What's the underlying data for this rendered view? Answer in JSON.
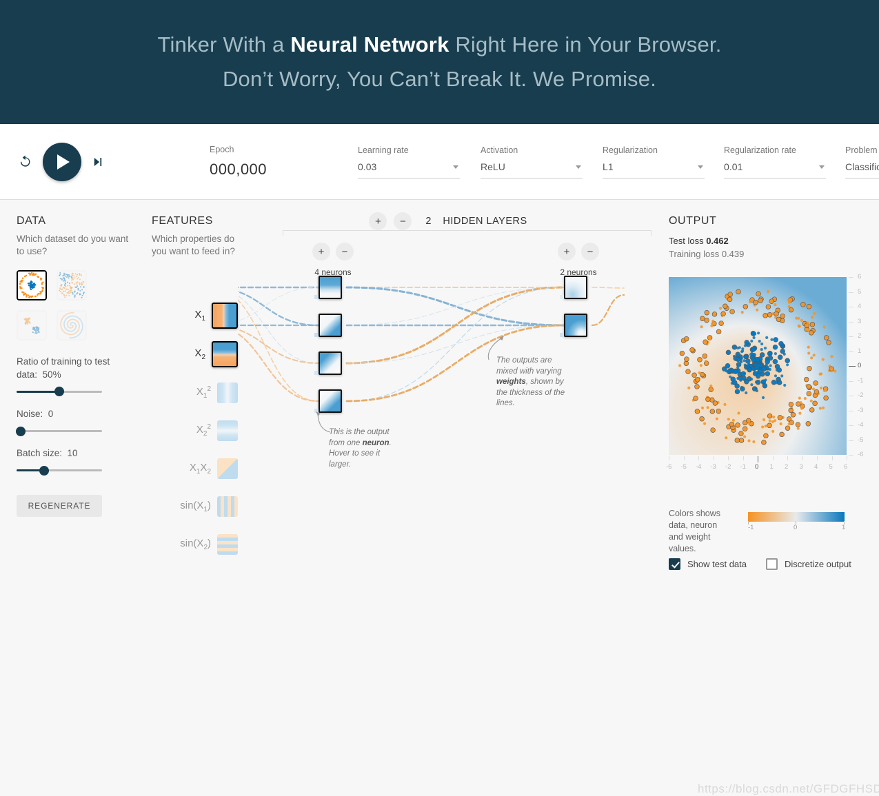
{
  "header": {
    "line1_pre": "Tinker With a ",
    "line1_strong": "Neural Network",
    "line1_post": " Right Here in Your Browser.",
    "line2": "Don’t Worry, You Can’t Break It. We Promise."
  },
  "toolbar": {
    "reset_icon": "reset-icon",
    "play_icon": "play-icon",
    "step_icon": "step-forward-icon",
    "epoch_label": "Epoch",
    "epoch_value": "000,000",
    "learning_rate_label": "Learning rate",
    "learning_rate_value": "0.03",
    "activation_label": "Activation",
    "activation_value": "ReLU",
    "regularization_label": "Regularization",
    "regularization_value": "L1",
    "regularization_rate_label": "Regularization rate",
    "regularization_rate_value": "0.01",
    "problem_type_label": "Problem type",
    "problem_type_value": "Classification"
  },
  "data": {
    "title": "DATA",
    "subtitle": "Which dataset do you want to use?",
    "datasets": [
      {
        "name": "circle",
        "selected": true
      },
      {
        "name": "xor",
        "selected": false
      },
      {
        "name": "gauss",
        "selected": false
      },
      {
        "name": "spiral",
        "selected": false
      }
    ],
    "ratio_label": "Ratio of training to test data:",
    "ratio_value": "50%",
    "ratio_pct": 50,
    "noise_label": "Noise:",
    "noise_value": "0",
    "noise_pct": 0,
    "batch_label": "Batch size:",
    "batch_value": "10",
    "batch_pct": 33,
    "regenerate_label": "REGENERATE"
  },
  "features": {
    "title": "FEATURES",
    "subtitle": "Which properties do you want to feed in?",
    "items": [
      {
        "label": "X₁",
        "active": true
      },
      {
        "label": "X₂",
        "active": true
      },
      {
        "label": "X₁²",
        "active": false
      },
      {
        "label": "X₂²",
        "active": false
      },
      {
        "label": "X₁X₂",
        "active": false
      },
      {
        "label": "sin(X₁)",
        "active": false
      },
      {
        "label": "sin(X₂)",
        "active": false
      }
    ]
  },
  "network": {
    "hidden_layer_count": "2",
    "hidden_layers_label": "HIDDEN LAYERS",
    "add_layer_label": "+",
    "remove_layer_label": "−",
    "layers": [
      {
        "neurons_label": "4 neurons",
        "count": 4
      },
      {
        "neurons_label": "2 neurons",
        "count": 2
      }
    ],
    "callout_neuron": {
      "pre": "This is the output from one ",
      "strong": "neuron",
      "post": ". Hover to see it larger."
    },
    "callout_weights": {
      "pre": "The outputs are mixed with varying ",
      "strong": "weights",
      "post": ", shown by the thickness of the lines."
    }
  },
  "output": {
    "title": "OUTPUT",
    "test_loss_label": "Test loss",
    "test_loss_value": "0.462",
    "training_loss_label": "Training loss",
    "training_loss_value": "0.439",
    "legend_text": "Colors shows data, neuron and weight values.",
    "legend_min": "-1",
    "legend_mid": "0",
    "legend_max": "1",
    "show_test_data_label": "Show test data",
    "show_test_data_checked": true,
    "discretize_label": "Discretize output",
    "discretize_checked": false,
    "axis_ticks": [
      "-6",
      "-5",
      "-4",
      "-3",
      "-2",
      "-1",
      "0",
      "1",
      "2",
      "3",
      "4",
      "5",
      "6"
    ]
  },
  "watermark": "https://blog.csdn.net/GFDGFHSDS",
  "colors": {
    "header_bg": "#183d4e",
    "accent": "#183d4e",
    "positive": "#0877bd",
    "negative": "#f59322",
    "neutral": "#e8eaeb"
  }
}
